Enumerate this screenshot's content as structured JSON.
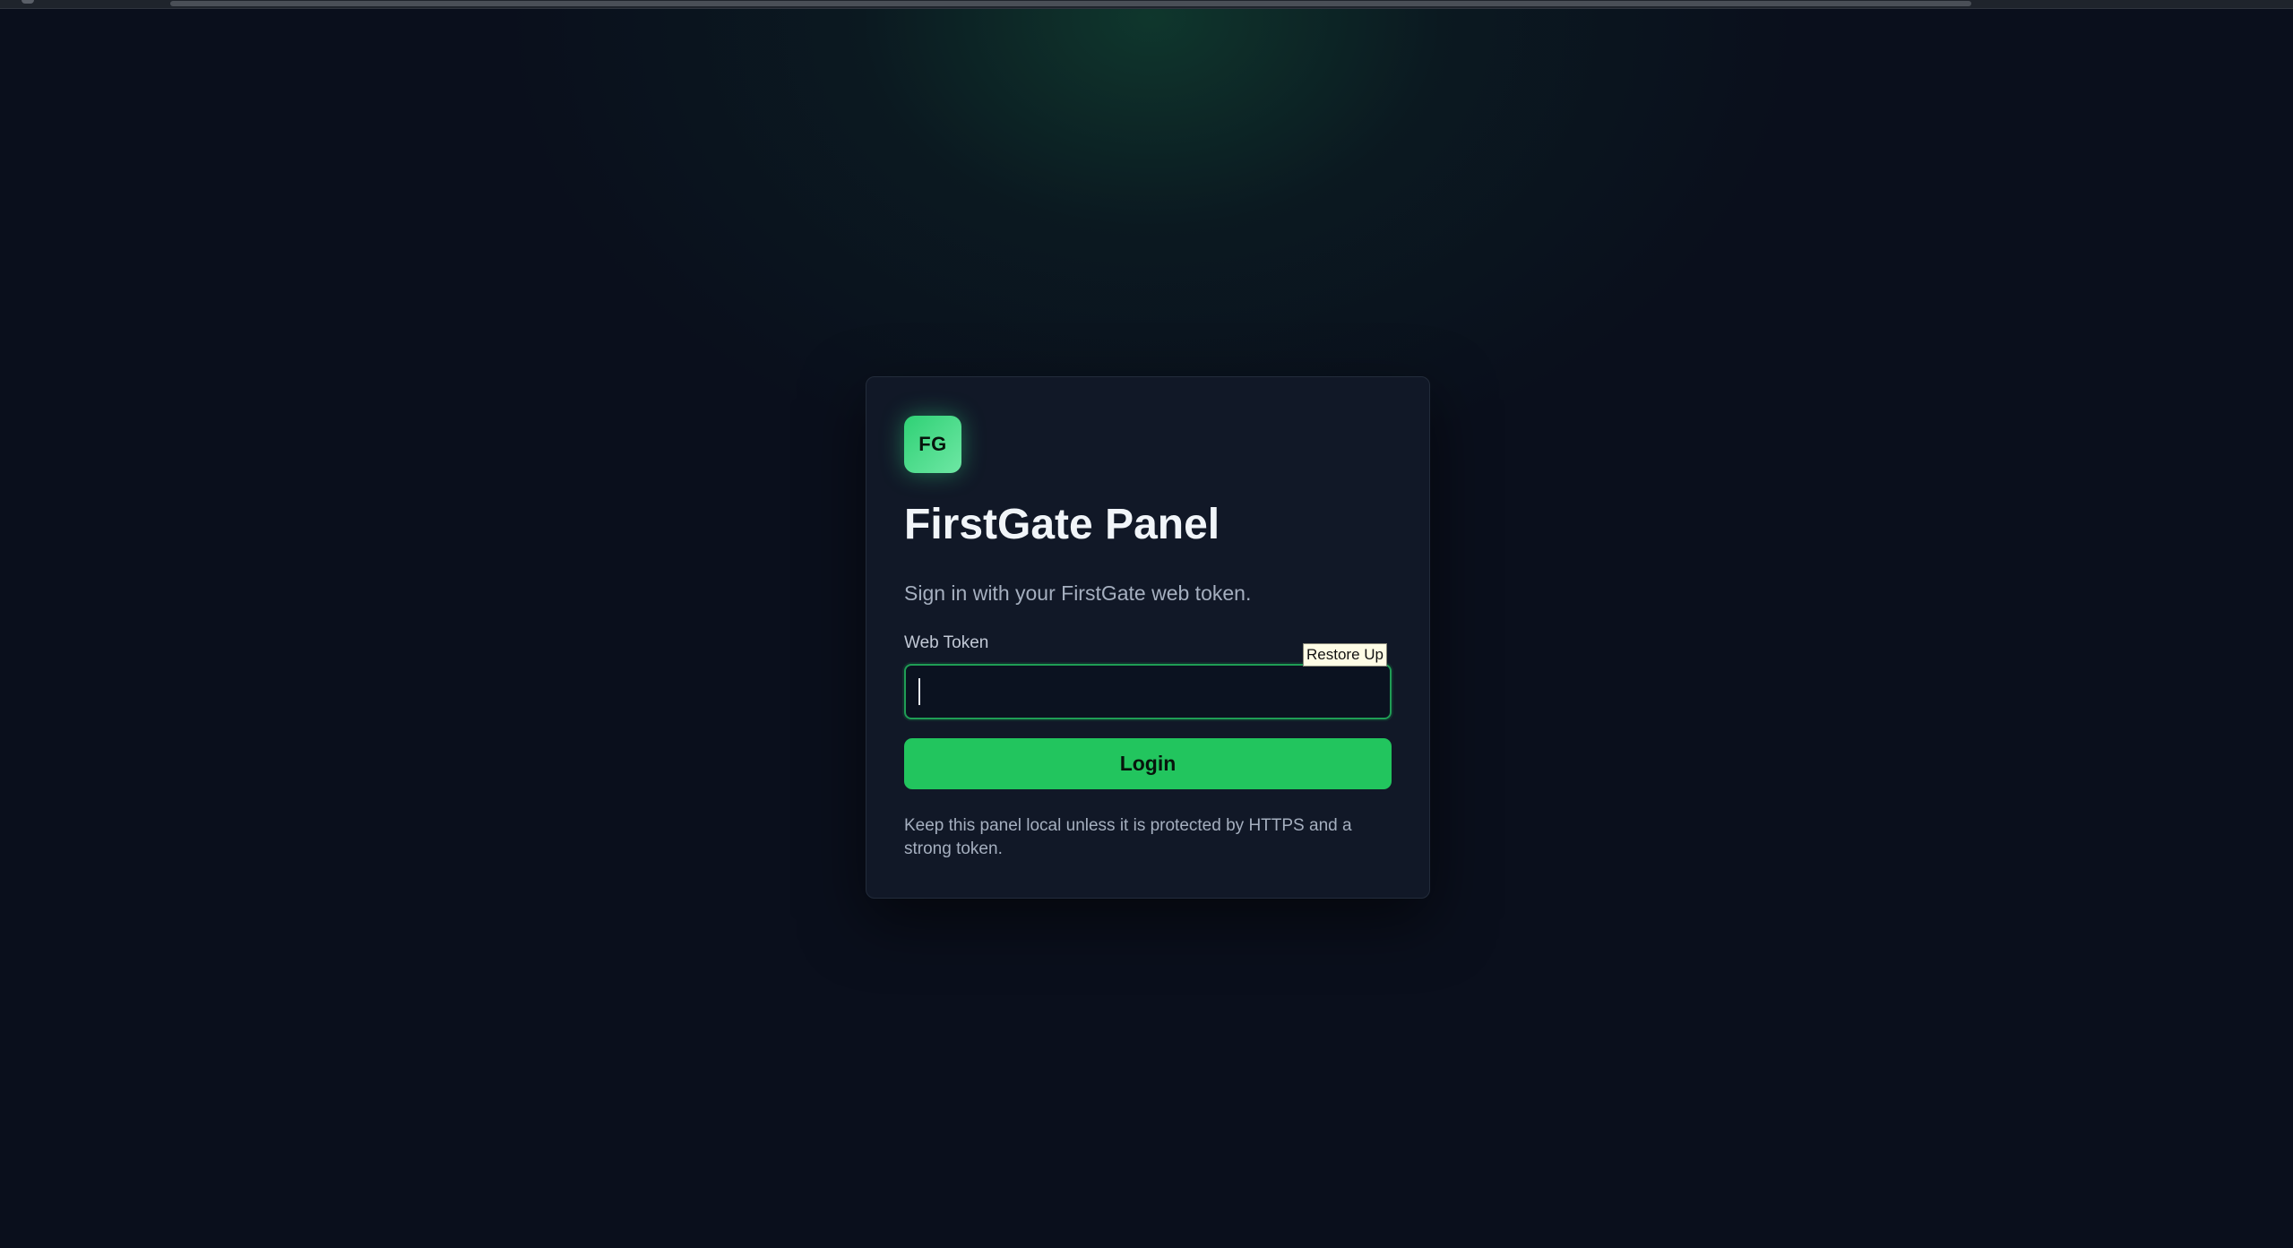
{
  "app": {
    "logo_text": "FG",
    "title": "FirstGate Panel",
    "subtitle": "Sign in with your FirstGate web token."
  },
  "form": {
    "token_label": "Web Token",
    "token_value": "",
    "login_label": "Login"
  },
  "tooltip": {
    "text": "Restore Up"
  },
  "footer": {
    "note": "Keep this panel local unless it is protected by HTTPS and a strong token."
  },
  "colors": {
    "background": "#0a0f1c",
    "card": "#111827",
    "accent": "#22c55e",
    "input_border": "#1f9d55"
  }
}
